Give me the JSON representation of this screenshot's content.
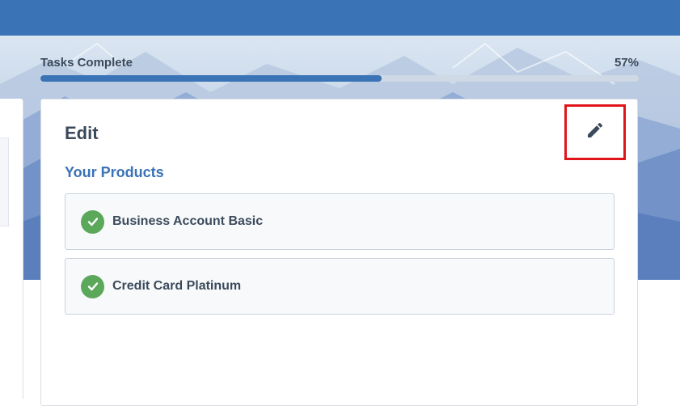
{
  "progress": {
    "label": "Tasks Complete",
    "percent_text": "57%",
    "value": 0.57
  },
  "card": {
    "title": "Edit",
    "edit_icon": "pencil-icon",
    "section_title": "Your Products",
    "products": [
      {
        "label": "Business Account Basic",
        "icon": "check-circle-icon",
        "status_color": "#5ba85a"
      },
      {
        "label": "Credit Card Platinum",
        "icon": "check-circle-icon",
        "status_color": "#5ba85a"
      }
    ]
  },
  "colors": {
    "header": "#3a73b6",
    "accent": "#3a73b6",
    "text": "#3b4a5a",
    "success": "#5ba85a",
    "highlight": "#e0151a"
  }
}
